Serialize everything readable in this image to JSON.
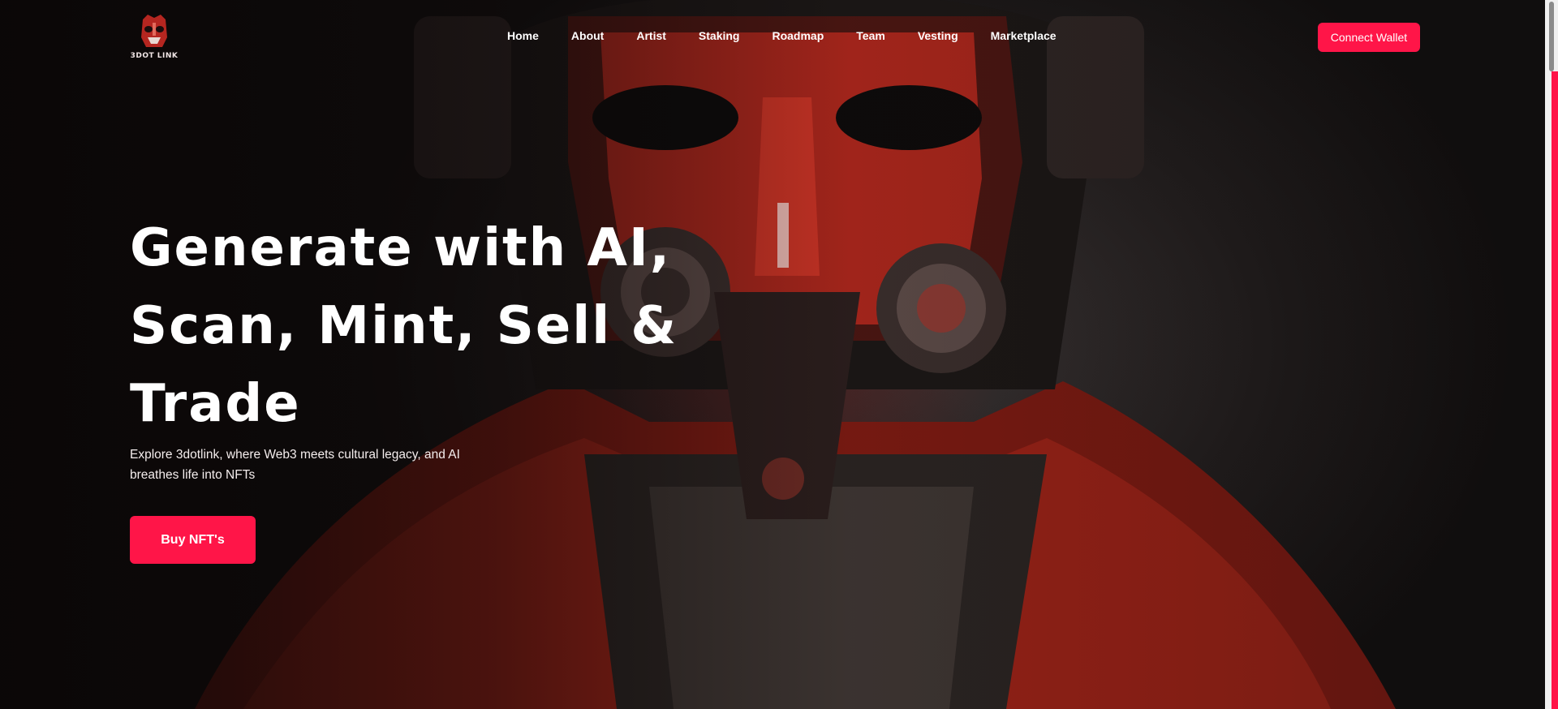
{
  "brand": {
    "logo_text": "3DOT LINK",
    "logo_icon": "mask-mascot-icon"
  },
  "nav": {
    "links": [
      "Home",
      "About",
      "Artist",
      "Staking",
      "Roadmap",
      "Team",
      "Vesting",
      "Marketplace"
    ],
    "connect_label": "Connect Wallet"
  },
  "hero": {
    "headline_line1": "Generate with AI,",
    "headline_line2": "Scan, Mint, Sell &",
    "headline_line3": "Trade",
    "subtitle": "Explore 3dotlink, where Web3 meets cultural legacy, and AI breathes life into NFTs",
    "cta_label": "Buy NFT's",
    "background_image": "red-masked-cyber-figure"
  },
  "colors": {
    "accent": "#ff1548",
    "background": "#151313",
    "text": "#ffffff"
  }
}
